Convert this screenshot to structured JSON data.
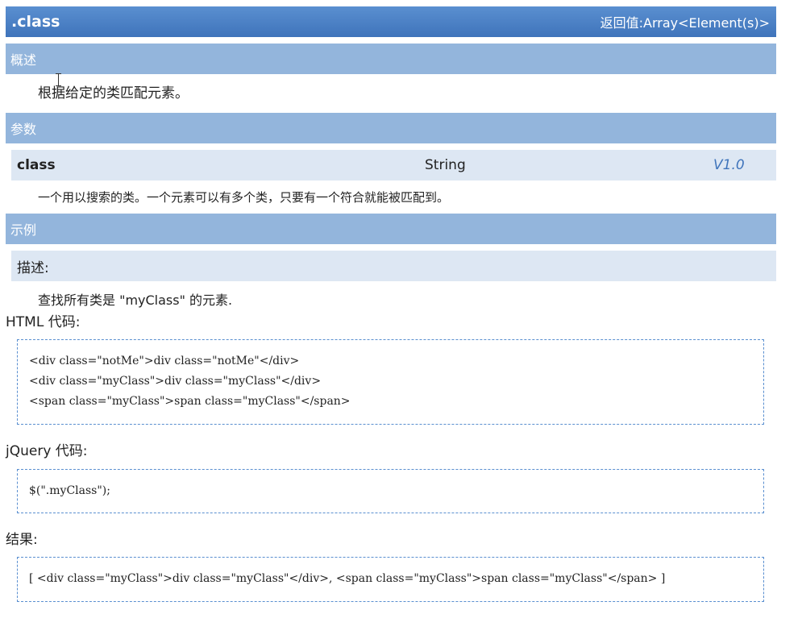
{
  "header": {
    "title": ".class",
    "return_value": "返回值:Array<Element(s)>"
  },
  "overview": {
    "heading": "概述",
    "text": "根据给定的类匹配元素。"
  },
  "params": {
    "heading": "参数",
    "name": "class",
    "type": "String",
    "version": "V1.0",
    "description": "一个用以搜索的类。一个元素可以有多个类，只要有一个符合就能被匹配到。"
  },
  "example": {
    "heading": "示例",
    "desc_label": "描述:",
    "desc_text": "查找所有类是 \"myClass\" 的元素.",
    "html_label": "HTML 代码:",
    "html_lines": [
      "<div class=\"notMe\">div class=\"notMe\"</div>",
      "<div class=\"myClass\">div class=\"myClass\"</div>",
      "<span class=\"myClass\">span class=\"myClass\"</span>"
    ],
    "jquery_label": "jQuery 代码:",
    "jquery_code": "$(\".myClass\");",
    "result_label": "结果:",
    "result_code": "[ <div class=\"myClass\">div class=\"myClass\"</div>, <span class=\"myClass\">span class=\"myClass\"</span> ]"
  }
}
